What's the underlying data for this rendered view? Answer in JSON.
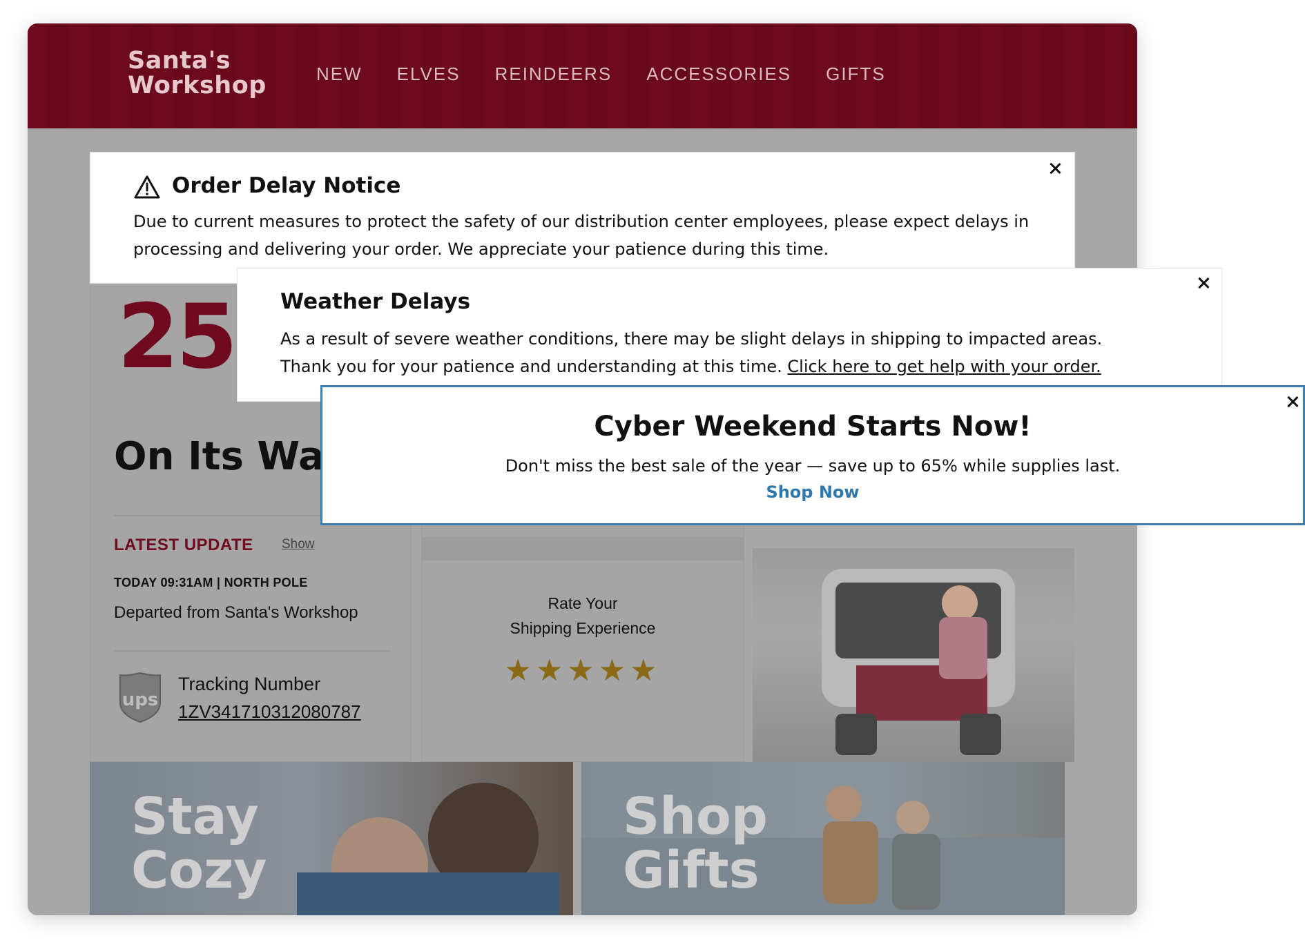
{
  "header": {
    "logo_line1": "Santa's",
    "logo_line2": "Workshop",
    "nav": [
      "NEW",
      "ELVES",
      "REINDEERS",
      "ACCESSORIES",
      "GIFTS"
    ]
  },
  "background": {
    "count": "25",
    "status_heading": "On Its Way",
    "latest_update_label": "LATEST UPDATE",
    "show_link": "Show",
    "update_time": "TODAY  09:31AM | NORTH POLE",
    "update_text": "Departed from Santa's Workshop",
    "tracking_label": "Tracking Number",
    "tracking_number": "1ZV341710312080787",
    "ups_label": "ups",
    "rate_line1": "Rate Your",
    "rate_line2": "Shipping Experience",
    "stars": "★★★★★",
    "banner_cozy_line1": "Stay",
    "banner_cozy_line2": "Cozy",
    "banner_gifts_line1": "Shop",
    "banner_gifts_line2": "Gifts"
  },
  "notices": {
    "order_delay": {
      "title": "Order Delay Notice",
      "body": "Due to current measures to protect the safety of our distribution center employees, please expect delays in processing and delivering your order. We appreciate your patience during this time."
    },
    "weather": {
      "title": "Weather Delays",
      "body_line1": "As a result of severe weather conditions, there may be slight delays in shipping to impacted areas.",
      "body_line2": "Thank you for your patience and understanding at this time. ",
      "link": "Click here to get help with your order."
    },
    "cyber": {
      "title": "Cyber Weekend Starts Now!",
      "body": "Don't miss the best sale of the year — save up to 65% while supplies last.",
      "cta": "Shop Now"
    }
  },
  "colors": {
    "header_bg": "#6e0a1e",
    "accent_red": "#6f0a1e",
    "cta_blue": "#2f78ad",
    "cyber_border": "#3f7fb0",
    "overlay_grey": "#a7a7a7",
    "star_gold": "#8a6a16"
  },
  "icons": {
    "warning": "warning-triangle-icon",
    "close": "close-icon",
    "carrier": "ups-shield-icon"
  }
}
